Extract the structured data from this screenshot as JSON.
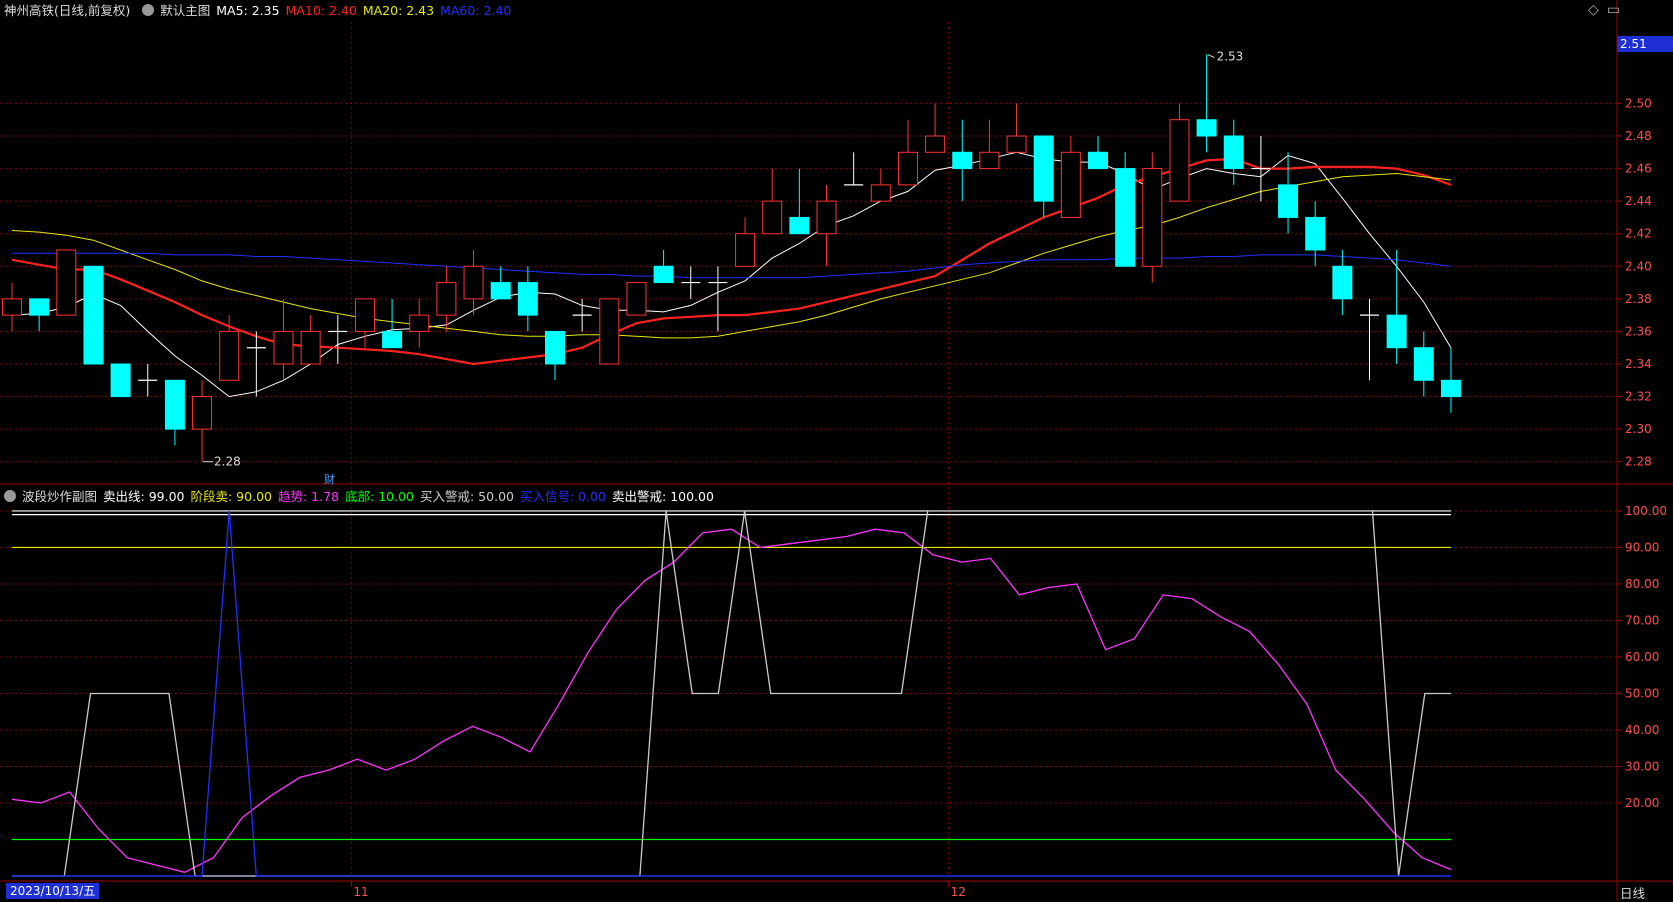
{
  "main_header": {
    "title": "神州高铁(日线,前复权)",
    "indicator_name": "默认主图",
    "ma": [
      {
        "label": "MA5: 2.35",
        "color": "#ffffff"
      },
      {
        "label": "MA10: 2.40",
        "color": "#ff2020"
      },
      {
        "label": "MA20: 2.43",
        "color": "#e8e800"
      },
      {
        "label": "MA60: 2.40",
        "color": "#2030ff"
      }
    ]
  },
  "sub_header": {
    "indicator_name": "波段炒作副图",
    "items": [
      {
        "label": "卖出线: 99.00",
        "color": "#ffffff"
      },
      {
        "label": "阶段卖: 90.00",
        "color": "#e8e800"
      },
      {
        "label": "趋势: 1.78",
        "color": "#ff33ff"
      },
      {
        "label": "底部: 10.00",
        "color": "#00ff00"
      },
      {
        "label": "买入警戒: 50.00",
        "color": "#cccccc"
      },
      {
        "label": "买入信号: 0.00",
        "color": "#2030ff"
      },
      {
        "label": "卖出警戒: 100.00",
        "color": "#ffffff"
      }
    ]
  },
  "top_icons": [
    "◇",
    "▭"
  ],
  "current_price": "2.51",
  "date_label": "2023/10/13/五",
  "period_label": "日线",
  "month_labels": [
    {
      "text": "11",
      "index": 13
    },
    {
      "text": "12",
      "index": 35
    }
  ],
  "finance_marker": "财",
  "annotations": {
    "high": "2.53",
    "low": "2.28"
  },
  "colors": {
    "up": "#ff3232",
    "down": "#00ffff",
    "grid": "#8b0000",
    "axis_text": "#ff4d4d"
  },
  "chart_data": [
    {
      "type": "candlestick",
      "ylim": [
        2.27,
        2.55
      ],
      "y_ticks": [
        2.28,
        2.3,
        2.32,
        2.34,
        2.36,
        2.38,
        2.4,
        2.42,
        2.44,
        2.46,
        2.48,
        2.5
      ],
      "candles": [
        [
          2.37,
          2.38,
          2.39,
          2.36
        ],
        [
          2.38,
          2.37,
          2.38,
          2.36
        ],
        [
          2.37,
          2.41,
          2.41,
          2.37
        ],
        [
          2.4,
          2.34,
          2.4,
          2.34
        ],
        [
          2.34,
          2.32,
          2.34,
          2.32
        ],
        [
          2.33,
          2.33,
          2.34,
          2.32
        ],
        [
          2.33,
          2.3,
          2.33,
          2.29
        ],
        [
          2.3,
          2.32,
          2.33,
          2.28
        ],
        [
          2.33,
          2.36,
          2.37,
          2.33
        ],
        [
          2.35,
          2.35,
          2.36,
          2.32
        ],
        [
          2.34,
          2.36,
          2.38,
          2.33
        ],
        [
          2.34,
          2.36,
          2.37,
          2.34
        ],
        [
          2.36,
          2.36,
          2.37,
          2.34
        ],
        [
          2.36,
          2.38,
          2.38,
          2.35
        ],
        [
          2.36,
          2.35,
          2.38,
          2.35
        ],
        [
          2.36,
          2.37,
          2.38,
          2.35
        ],
        [
          2.37,
          2.39,
          2.4,
          2.36
        ],
        [
          2.38,
          2.4,
          2.41,
          2.37
        ],
        [
          2.39,
          2.38,
          2.4,
          2.38
        ],
        [
          2.39,
          2.37,
          2.4,
          2.36
        ],
        [
          2.36,
          2.34,
          2.36,
          2.33
        ],
        [
          2.37,
          2.37,
          2.38,
          2.36
        ],
        [
          2.34,
          2.38,
          2.38,
          2.34
        ],
        [
          2.37,
          2.39,
          2.39,
          2.37
        ],
        [
          2.4,
          2.39,
          2.41,
          2.39
        ],
        [
          2.39,
          2.39,
          2.4,
          2.38
        ],
        [
          2.39,
          2.39,
          2.4,
          2.36
        ],
        [
          2.4,
          2.42,
          2.43,
          2.4
        ],
        [
          2.42,
          2.44,
          2.46,
          2.42
        ],
        [
          2.43,
          2.42,
          2.46,
          2.42
        ],
        [
          2.42,
          2.44,
          2.45,
          2.4
        ],
        [
          2.45,
          2.45,
          2.47,
          2.45
        ],
        [
          2.44,
          2.45,
          2.46,
          2.44
        ],
        [
          2.45,
          2.47,
          2.49,
          2.45
        ],
        [
          2.47,
          2.48,
          2.5,
          2.47
        ],
        [
          2.47,
          2.46,
          2.49,
          2.44
        ],
        [
          2.46,
          2.47,
          2.49,
          2.46
        ],
        [
          2.47,
          2.48,
          2.5,
          2.47
        ],
        [
          2.48,
          2.44,
          2.48,
          2.43
        ],
        [
          2.43,
          2.47,
          2.48,
          2.43
        ],
        [
          2.47,
          2.46,
          2.48,
          2.46
        ],
        [
          2.46,
          2.4,
          2.47,
          2.4
        ],
        [
          2.4,
          2.46,
          2.47,
          2.39
        ],
        [
          2.44,
          2.49,
          2.5,
          2.44
        ],
        [
          2.49,
          2.48,
          2.53,
          2.47
        ],
        [
          2.48,
          2.46,
          2.49,
          2.45
        ],
        [
          2.46,
          2.46,
          2.48,
          2.44
        ],
        [
          2.45,
          2.43,
          2.47,
          2.42
        ],
        [
          2.43,
          2.41,
          2.44,
          2.4
        ],
        [
          2.4,
          2.38,
          2.41,
          2.37
        ],
        [
          2.37,
          2.37,
          2.38,
          2.33
        ],
        [
          2.37,
          2.35,
          2.41,
          2.34
        ],
        [
          2.35,
          2.33,
          2.36,
          2.32
        ],
        [
          2.33,
          2.32,
          2.35,
          2.31
        ]
      ],
      "ma_series": [
        {
          "name": "MA5",
          "color": "#ffffff",
          "width": 1,
          "values": [
            2.37,
            2.371,
            2.375,
            2.383,
            2.376,
            2.36,
            2.345,
            2.333,
            2.32,
            2.323,
            2.33,
            2.34,
            2.352,
            2.357,
            2.361,
            2.362,
            2.364,
            2.373,
            2.381,
            2.384,
            2.383,
            2.376,
            2.373,
            2.373,
            2.372,
            2.376,
            2.384,
            2.391,
            2.405,
            2.414,
            2.425,
            2.431,
            2.44,
            2.446,
            2.459,
            2.462,
            2.466,
            2.47,
            2.466,
            2.464,
            2.464,
            2.457,
            2.447,
            2.454,
            2.46,
            2.457,
            2.455,
            2.468,
            2.463,
            2.442,
            2.42,
            2.4,
            2.378,
            2.35
          ]
        },
        {
          "name": "MA10",
          "color": "#ff2020",
          "width": 2.2,
          "values": [
            2.404,
            2.401,
            2.398,
            2.398,
            2.392,
            2.385,
            2.378,
            2.37,
            2.363,
            2.357,
            2.352,
            2.351,
            2.35,
            2.349,
            2.348,
            2.346,
            2.343,
            2.34,
            2.342,
            2.344,
            2.346,
            2.35,
            2.358,
            2.365,
            2.368,
            2.369,
            2.37,
            2.37,
            2.372,
            2.374,
            2.378,
            2.382,
            2.386,
            2.39,
            2.394,
            2.404,
            2.414,
            2.422,
            2.43,
            2.436,
            2.442,
            2.45,
            2.455,
            2.46,
            2.465,
            2.466,
            2.46,
            2.46,
            2.461,
            2.461,
            2.461,
            2.46,
            2.456,
            2.45
          ]
        },
        {
          "name": "MA20",
          "color": "#e8e800",
          "width": 1,
          "values": [
            2.422,
            2.421,
            2.419,
            2.416,
            2.41,
            2.404,
            2.398,
            2.391,
            2.386,
            2.382,
            2.378,
            2.374,
            2.371,
            2.368,
            2.366,
            2.364,
            2.362,
            2.36,
            2.358,
            2.357,
            2.357,
            2.358,
            2.358,
            2.357,
            2.356,
            2.356,
            2.357,
            2.36,
            2.363,
            2.366,
            2.37,
            2.375,
            2.38,
            2.384,
            2.388,
            2.392,
            2.396,
            2.402,
            2.408,
            2.413,
            2.418,
            2.422,
            2.425,
            2.43,
            2.436,
            2.441,
            2.446,
            2.449,
            2.452,
            2.455,
            2.456,
            2.457,
            2.455,
            2.453
          ]
        },
        {
          "name": "MA60",
          "color": "#2030ff",
          "width": 1,
          "values": [
            2.408,
            2.408,
            2.408,
            2.408,
            2.408,
            2.408,
            2.407,
            2.407,
            2.407,
            2.406,
            2.406,
            2.405,
            2.404,
            2.403,
            2.402,
            2.401,
            2.4,
            2.399,
            2.398,
            2.397,
            2.396,
            2.395,
            2.395,
            2.394,
            2.394,
            2.393,
            2.393,
            2.393,
            2.393,
            2.393,
            2.394,
            2.395,
            2.396,
            2.397,
            2.399,
            2.401,
            2.402,
            2.403,
            2.404,
            2.404,
            2.404,
            2.405,
            2.405,
            2.405,
            2.406,
            2.406,
            2.407,
            2.407,
            2.407,
            2.406,
            2.405,
            2.404,
            2.402,
            2.4
          ]
        }
      ]
    },
    {
      "type": "line",
      "ylim": [
        0,
        103
      ],
      "y_ticks": [
        20,
        30,
        40,
        50,
        60,
        70,
        80,
        90,
        100
      ],
      "hlines": [
        {
          "name": "卖出线",
          "value": 99,
          "color": "#ffffff"
        },
        {
          "name": "卖出警戒",
          "value": 100,
          "color": "#ffffff"
        },
        {
          "name": "阶段卖",
          "value": 90,
          "color": "#e8e800"
        },
        {
          "name": "底部",
          "value": 10,
          "color": "#00ff00"
        },
        {
          "name": "买入信号",
          "value": 0,
          "color": "#2030ff"
        }
      ],
      "series": [
        {
          "name": "趋势",
          "color": "#ff33ff",
          "values": [
            21,
            20,
            23,
            13,
            5,
            3,
            1,
            5,
            16,
            22,
            27,
            29,
            32,
            29,
            32,
            37,
            41,
            38,
            34,
            47,
            61,
            73,
            81,
            86,
            94,
            95,
            90,
            91,
            92,
            93,
            95,
            94,
            88,
            86,
            87,
            77,
            79,
            80,
            62,
            65,
            77,
            76,
            71,
            67,
            58,
            47,
            29,
            21,
            12,
            5,
            1.78
          ]
        },
        {
          "name": "买入警戒",
          "color": "#cccccc",
          "values": [
            0,
            0,
            0,
            50,
            50,
            50,
            50,
            0,
            0,
            0,
            0,
            0,
            0,
            0,
            0,
            0,
            0,
            0,
            0,
            0,
            0,
            0,
            0,
            0,
            0,
            100,
            50,
            50,
            100,
            50,
            50,
            50,
            50,
            50,
            50,
            100,
            100,
            100,
            100,
            100,
            100,
            100,
            100,
            100,
            100,
            100,
            100,
            100,
            100,
            100,
            100,
            100,
            100,
            0,
            50,
            50
          ]
        },
        {
          "name": "买入信号",
          "color": "#2030ff",
          "values": [
            0,
            0,
            0,
            0,
            0,
            0,
            0,
            0,
            100,
            0,
            0,
            0,
            0,
            0,
            0,
            0,
            0,
            0,
            0,
            0,
            0,
            0,
            0,
            0,
            0,
            0,
            0,
            0,
            0,
            0,
            0,
            0,
            0,
            0,
            0,
            0,
            0,
            0,
            0,
            0,
            0,
            0,
            0,
            0,
            0,
            0,
            0,
            0,
            0,
            0,
            0,
            0,
            0,
            0
          ]
        }
      ]
    }
  ]
}
